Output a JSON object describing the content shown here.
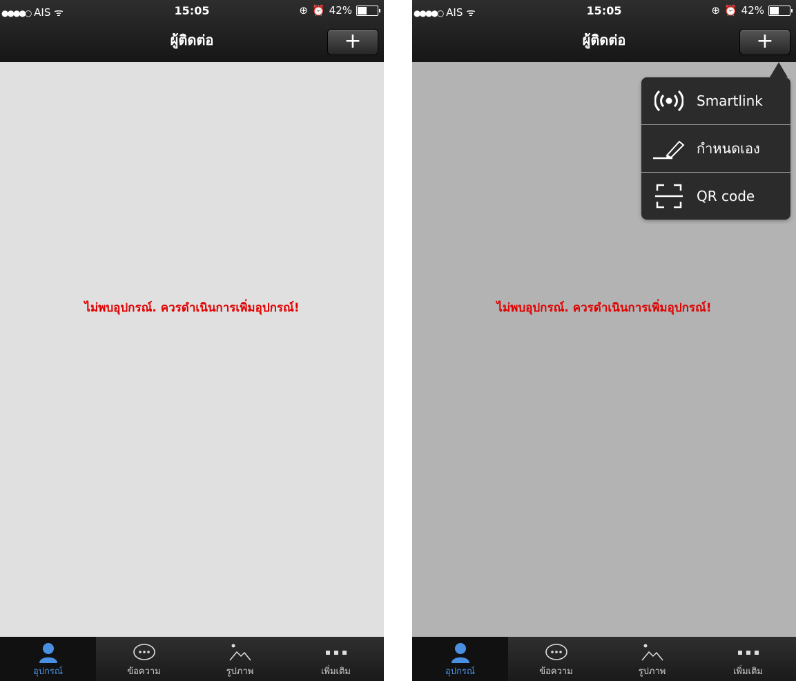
{
  "status": {
    "carrier": "AIS",
    "time": "15:05",
    "battery": "42%"
  },
  "nav": {
    "title": "ผู้ติดต่อ",
    "add_label": "+"
  },
  "empty_message": "ไม่พบอุปกรณ์. ควรดำเนินการเพิ่มอุปกรณ์!",
  "tabs": [
    {
      "label": "อุปกรณ์",
      "icon": "person-icon",
      "active": true
    },
    {
      "label": "ข้อความ",
      "icon": "chat-bubble-icon",
      "active": false
    },
    {
      "label": "รูปภาพ",
      "icon": "image-icon",
      "active": false
    },
    {
      "label": "เพิ่มเติม",
      "icon": "more-icon",
      "active": false
    }
  ],
  "menu": {
    "items": [
      {
        "label": "Smartlink",
        "icon": "broadcast-icon"
      },
      {
        "label": "กำหนดเอง",
        "icon": "pencil-icon"
      },
      {
        "label": "QR code",
        "icon": "qr-scan-icon"
      }
    ]
  },
  "colors": {
    "active_tab": "#4a90e2",
    "empty_message": "#e00000",
    "bar_background": "#1a1a1a"
  }
}
